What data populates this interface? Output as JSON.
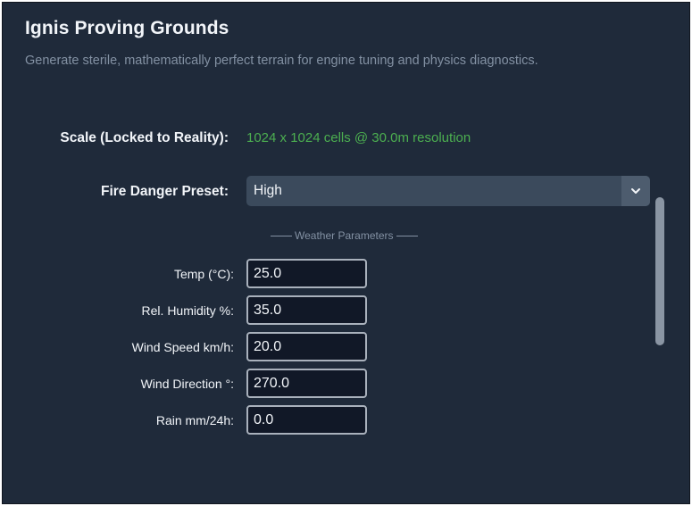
{
  "app": {
    "title": "Ignis Proving Grounds",
    "subtitle": "Generate sterile, mathematically perfect terrain for engine tuning and physics diagnostics."
  },
  "scale": {
    "label": "Scale (Locked to Reality):",
    "value": "1024 x 1024 cells @ 30.0m resolution",
    "value_color": "#4caf50"
  },
  "preset": {
    "label": "Fire Danger Preset:",
    "selected": "High",
    "arrow_icon": "chevron-down-icon"
  },
  "weather": {
    "header": "Weather Parameters",
    "params": [
      {
        "label": "Temp (°C):",
        "value": "25.0"
      },
      {
        "label": "Rel. Humidity %:",
        "value": "35.0"
      },
      {
        "label": "Wind Speed km/h:",
        "value": "20.0"
      },
      {
        "label": "Wind Direction °:",
        "value": "270.0"
      },
      {
        "label": "Rain mm/24h:",
        "value": "0.0"
      }
    ]
  },
  "colors": {
    "background": "#1f2a3a",
    "accent_green": "#4caf50",
    "input_background": "#111827"
  }
}
